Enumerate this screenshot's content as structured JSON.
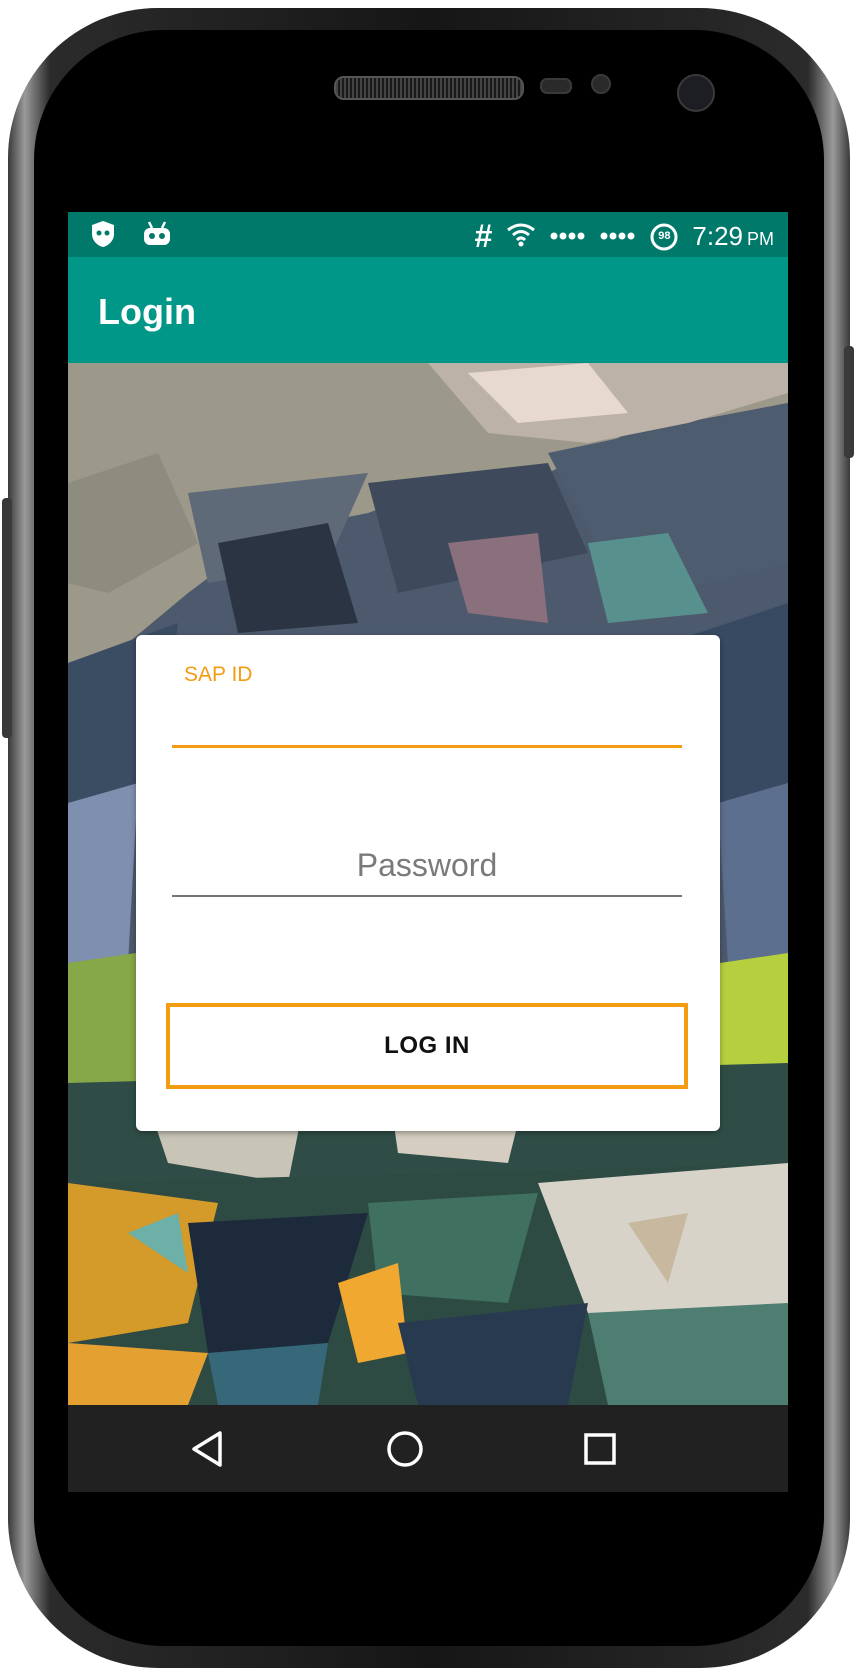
{
  "status_bar": {
    "time": "7:29",
    "ampm": "PM",
    "battery_level": "98",
    "icons": [
      "robot-shield-icon",
      "android-icon",
      "hashtag-icon",
      "wifi-icon",
      "signal-dots-icon",
      "signal-dots-icon",
      "battery-icon"
    ]
  },
  "app_bar": {
    "title": "Login"
  },
  "form": {
    "sap_id_label": "SAP ID",
    "sap_id_value": "",
    "password_placeholder": "Password",
    "login_button_label": "LOG IN"
  },
  "nav_bar": {
    "icons": [
      "back-icon",
      "home-icon",
      "recents-icon"
    ]
  },
  "colors": {
    "status_bar": "#00796b",
    "app_bar": "#009688",
    "accent": "#f39c12",
    "nav_bar": "#212121"
  }
}
